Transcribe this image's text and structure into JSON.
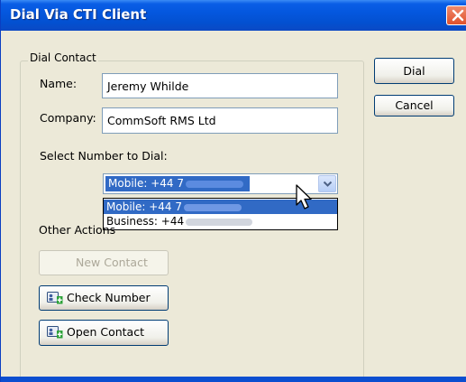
{
  "window": {
    "title": "Dial Via CTI Client"
  },
  "group": {
    "legend": "Dial Contact"
  },
  "form": {
    "name_label": "Name:",
    "name_value": "Jeremy Whilde",
    "company_label": "Company:",
    "company_value": "CommSoft RMS Ltd",
    "select_label": "Select Number to Dial:",
    "selected_value": "Mobile: +44 7",
    "options": [
      "Mobile: +44 7",
      "Business: +44"
    ]
  },
  "other_actions": {
    "label": "Other Actions",
    "new_contact": "New Contact",
    "check_number": "Check Number",
    "open_contact": "Open Contact"
  },
  "buttons": {
    "dial": "Dial",
    "cancel": "Cancel"
  },
  "colors": {
    "title_bar": "#0457de",
    "selection": "#316ac5",
    "dialog_bg": "#ece9d8",
    "close_button": "#e0512c"
  },
  "icons": [
    "close-icon",
    "dropdown-arrow-icon",
    "contact-card-add-icon",
    "mouse-pointer-icon"
  ]
}
